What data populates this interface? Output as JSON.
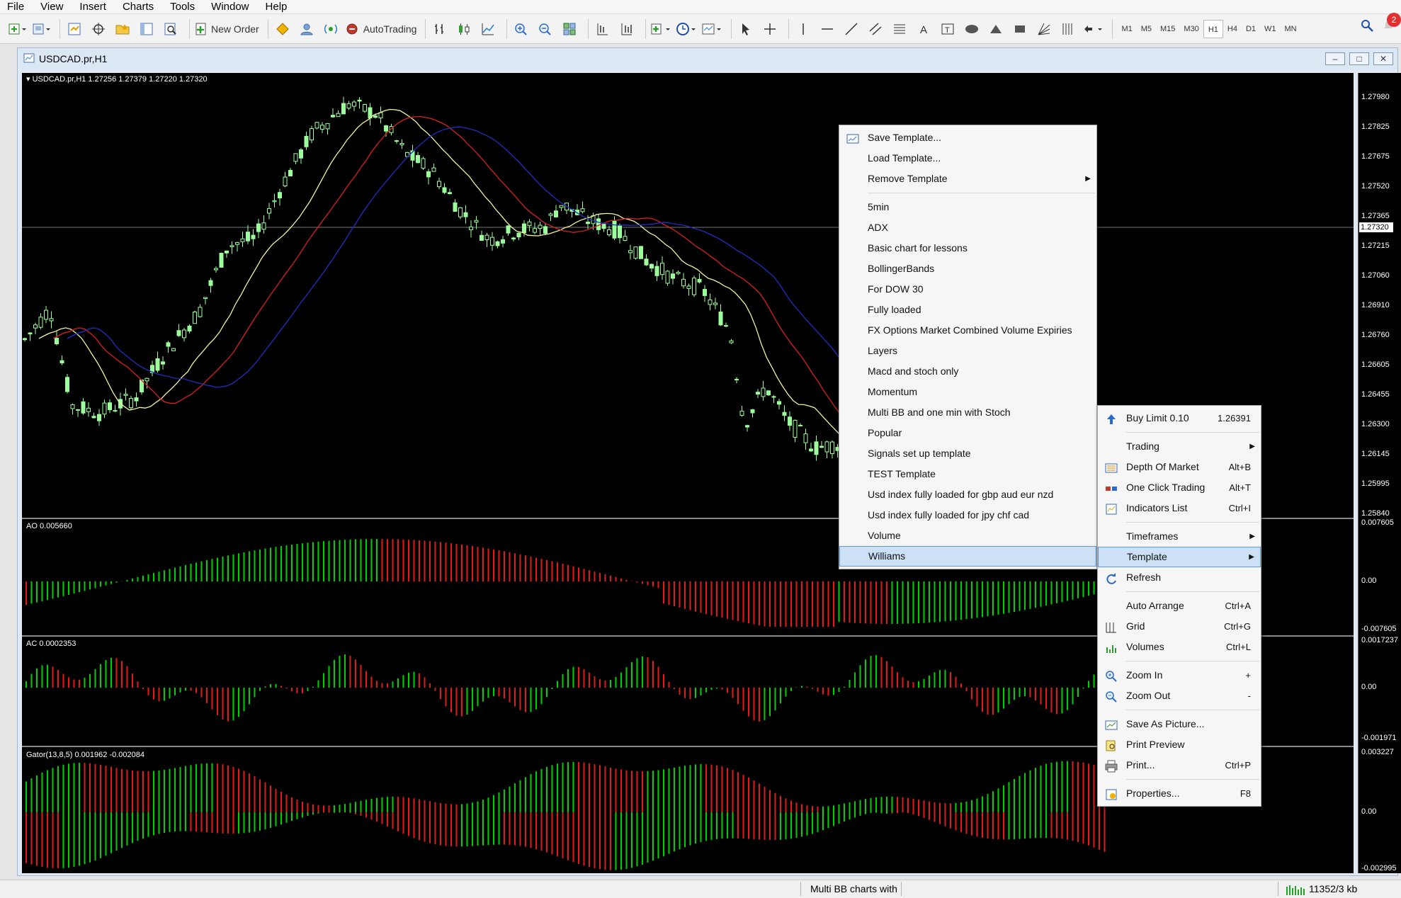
{
  "menubar": {
    "items": [
      "File",
      "View",
      "Insert",
      "Charts",
      "Tools",
      "Window",
      "Help"
    ]
  },
  "toolbar": {
    "new_order_label": "New Order",
    "autotrading_label": "AutoTrading",
    "timeframes": [
      "M1",
      "M5",
      "M15",
      "M30",
      "H1",
      "H4",
      "D1",
      "W1",
      "MN"
    ],
    "active_timeframe": "H1",
    "notification_count": "2"
  },
  "chart_window": {
    "title": "USDCAD.pr,H1"
  },
  "chart": {
    "symbol_header": "USDCAD.pr,H1  1.27256 1.27379 1.27220 1.27320",
    "current_price": "1.27320",
    "price_ticks": [
      "1.27980",
      "1.27825",
      "1.27675",
      "1.27520",
      "1.27365",
      "1.27215",
      "1.27060",
      "1.26910",
      "1.26760",
      "1.26605",
      "1.26455",
      "1.26300",
      "1.26145",
      "1.25995",
      "1.25840"
    ],
    "ao_label": "AO 0.005660",
    "ao_ticks": [
      "0.007605",
      "0.00",
      "-0.007605"
    ],
    "ac_label": "AC 0.0002353",
    "ac_ticks": [
      "0.0017237",
      "0.00",
      "-0.001971"
    ],
    "gator_label": "Gator(13,8,5) 0.001962 -0.002084",
    "gator_ticks": [
      "0.003227",
      "0.00",
      "-0.002995"
    ],
    "colors": {
      "bull": "#00d000",
      "bear": "#e21a1a",
      "candle_bull": "#9cff9c",
      "ma_fast": "#f2f2a0",
      "ma_mid": "#d82020",
      "ma_slow": "#1f2fbf"
    }
  },
  "template_menu": {
    "items": [
      {
        "label": "Save Template..."
      },
      {
        "label": "Load Template..."
      },
      {
        "label": "Remove Template",
        "submenu": true
      },
      {
        "sep": true
      },
      {
        "label": "5min"
      },
      {
        "label": "ADX"
      },
      {
        "label": "Basic chart for lessons"
      },
      {
        "label": "BollingerBands"
      },
      {
        "label": "For DOW 30"
      },
      {
        "label": "Fully loaded"
      },
      {
        "label": "FX Options Market Combined Volume Expiries"
      },
      {
        "label": "Layers"
      },
      {
        "label": "Macd and stoch only"
      },
      {
        "label": "Momentum"
      },
      {
        "label": "Multi BB and one min with Stoch"
      },
      {
        "label": "Popular"
      },
      {
        "label": "Signals set up template"
      },
      {
        "label": "TEST Template"
      },
      {
        "label": "Usd index fully loaded for gbp aud eur nzd"
      },
      {
        "label": "Usd index fully loaded for jpy chf cad"
      },
      {
        "label": "Volume"
      },
      {
        "label": "Williams",
        "selected": true
      }
    ]
  },
  "context_menu": {
    "items": [
      {
        "label": "Buy Limit 0.10",
        "shortcut": "1.26391",
        "icon": "buy-limit-icon"
      },
      {
        "sep": true
      },
      {
        "label": "Trading",
        "submenu": true
      },
      {
        "label": "Depth Of Market",
        "shortcut": "Alt+B",
        "icon": "depth-of-market-icon"
      },
      {
        "label": "One Click Trading",
        "shortcut": "Alt+T",
        "icon": "one-click-trading-icon"
      },
      {
        "label": "Indicators List",
        "shortcut": "Ctrl+I",
        "icon": "indicators-list-icon"
      },
      {
        "sep": true
      },
      {
        "label": "Timeframes",
        "submenu": true
      },
      {
        "label": "Template",
        "submenu": true,
        "selected": true
      },
      {
        "label": "Refresh",
        "icon": "refresh-icon"
      },
      {
        "sep": true
      },
      {
        "label": "Auto Arrange",
        "shortcut": "Ctrl+A"
      },
      {
        "label": "Grid",
        "shortcut": "Ctrl+G",
        "icon": "grid-icon"
      },
      {
        "label": "Volumes",
        "shortcut": "Ctrl+L",
        "icon": "volumes-icon"
      },
      {
        "sep": true
      },
      {
        "label": "Zoom In",
        "shortcut": "+",
        "icon": "zoom-in-icon"
      },
      {
        "label": "Zoom Out",
        "shortcut": "-",
        "icon": "zoom-out-icon"
      },
      {
        "sep": true
      },
      {
        "label": "Save As Picture...",
        "icon": "save-picture-icon"
      },
      {
        "label": "Print Preview",
        "icon": "print-preview-icon"
      },
      {
        "label": "Print...",
        "shortcut": "Ctrl+P",
        "icon": "print-icon"
      },
      {
        "sep": true
      },
      {
        "label": "Properties...",
        "shortcut": "F8",
        "icon": "properties-icon"
      }
    ]
  },
  "statusbar": {
    "profile": "Multi BB charts with",
    "traffic": "11352/3 kb"
  }
}
